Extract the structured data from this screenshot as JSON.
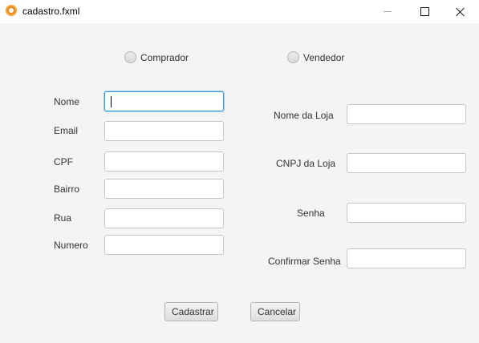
{
  "window": {
    "title": "cadastro.fxml"
  },
  "user_type": {
    "options": [
      {
        "label": "Comprador",
        "selected": false
      },
      {
        "label": "Vendedor",
        "selected": false
      }
    ]
  },
  "buyer_form": {
    "nome_label": "Nome",
    "nome_value": "",
    "email_label": "Email",
    "email_value": "",
    "cpf_label": "CPF",
    "cpf_value": "",
    "bairro_label": "Bairro",
    "bairro_value": "",
    "rua_label": "Rua",
    "rua_value": "",
    "numero_label": "Numero",
    "numero_value": ""
  },
  "seller_form": {
    "nome_loja_label": "Nome da Loja",
    "nome_loja_value": "",
    "cnpj_loja_label": "CNPJ da Loja",
    "cnpj_loja_value": "",
    "senha_label": "Senha",
    "senha_value": "",
    "confirmar_senha_label": "Confirmar Senha",
    "confirmar_senha_value": ""
  },
  "actions": {
    "cadastrar_label": "Cadastrar",
    "cancelar_label": "Cancelar"
  },
  "colors": {
    "focus_border": "#3a9ad9",
    "window_background": "#f4f4f4",
    "app_icon": "#e8891d"
  },
  "icons": {
    "app": "java-app-icon",
    "minimize": "minimize-icon",
    "maximize": "maximize-icon",
    "close": "close-icon"
  }
}
